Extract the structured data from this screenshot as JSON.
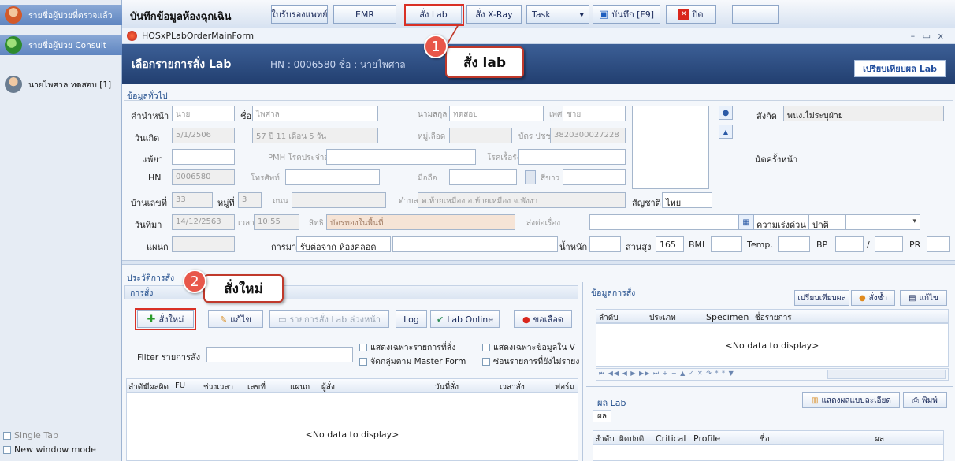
{
  "sidebar": {
    "items": [
      {
        "label": "รายชื่อผู้ป่วยที่ตรวจแล้ว",
        "color": "#5f85c0"
      },
      {
        "label": "รายชื่อผู้ป่วย Consult",
        "color": "#5f85c0"
      },
      {
        "label": "นายไพศาล ทดสอบ [1]",
        "color": "#dfe7f2"
      }
    ],
    "single_tab": "Single Tab",
    "new_window": "New window mode"
  },
  "toolbar": {
    "title": "บันทึกข้อมูลห้องฉุกเฉิน",
    "refer": "ใบรับรองแพทย์",
    "emr": "EMR",
    "lab": "สั่ง Lab",
    "xray": "สั่ง X-Ray",
    "task": "Task",
    "save": "บันทึก [F9]",
    "close": "ปิด"
  },
  "window": {
    "title": "HOSxPLabOrderMainForm",
    "controls": "–  ▭  x"
  },
  "header": {
    "title": "เลือกรายการสั่ง Lab",
    "hn": "HN : 0006580 ชื่อ : นายไพศาล",
    "compare": "เปรียบเทียบผล Lab"
  },
  "general": {
    "section": "ข้อมูลทั่วไป",
    "prefix_label": "คำนำหน้า",
    "prefix_value": "นาย",
    "fname_label": "ชื่อ",
    "fname_value": "ไพศาล",
    "lname_label": "นามสกุล",
    "lname_value": "ทดสอบ",
    "sex_label": "เพศ",
    "sex_value": "ชาย",
    "dob_label": "วันเกิด",
    "dob_value": "5/1/2506",
    "age_label": "อายุ",
    "age_value": "57 ปี 11 เดือน 5 วัน",
    "blood_label": "หมู่เลือด",
    "cid_label": "บัตร ปชช.",
    "cid_value": "3820300027228",
    "allergy_label": "แพ้ยา",
    "pmh_label": "PMH โรคประจำตัว",
    "disease_label": "โรคเรื้อรัง",
    "hn_label": "HN",
    "hn_value": "0006580",
    "phone_label": "โทรศัพท์",
    "mobile_label": "มือถือ",
    "ew_label": "สีขาว",
    "house_label": "บ้านเลขที่",
    "house_value": "33",
    "moo_label": "หมู่ที่",
    "moo_value": "3",
    "road_label": "ถนน",
    "tambon_label": "ตำบล",
    "tambon_value": "ต.ท้ายเหมือง อ.ท้ายเหมือง จ.พังงา",
    "nation_label": "สัญชาติ",
    "nation_value": "ไทย",
    "visit_label": "วันที่มา",
    "visit_value": "14/12/2563",
    "time_label": "เวลา",
    "time_value": "10:55",
    "right_label": "สิทธิ",
    "right_value": "บัตรทองในพื้นที่",
    "diag_label": "ส่งต่อเรื่อง",
    "dept_label": "แผนก",
    "trans_label": "การมา",
    "trans_value": "รับต่อจาก ห้องคลอด",
    "weight_label": "น้ำหนัก",
    "height_label": "ส่วนสูง",
    "height_value": "165",
    "bmi_label": "BMI",
    "temp_label": "Temp.",
    "bp_label": "BP",
    "bp_sep": "/",
    "pr_label": "PR",
    "affil_label": "สังกัด",
    "affil_value": "พนง.ไม่ระบุฝ่าย",
    "appoint_label": "นัดครั้งหน้า",
    "urgency_label": "ความเร่งด่วน",
    "urgency_value": "ปกติ"
  },
  "history": {
    "section": "ประวัติการสั่ง",
    "order_group": "การสั่ง",
    "btn_new": "สั่งใหม่",
    "btn_edit": "แก้ไข",
    "btn_preorder": "รายการสั่ง Lab ล่วงหน้า",
    "btn_log": "Log",
    "btn_online": "Lab Online",
    "btn_blood": "ขอเลือด",
    "filter_label": "Filter รายการสั่ง",
    "chk1": "แสดงเฉพาะรายการที่สั่ง",
    "chk2": "จัดกลุ่มตาม Master Form",
    "chk3": "แสดงเฉพาะข้อมูลใน V",
    "chk4": "ซ่อนรายการที่ยังไม่รายง",
    "columns": [
      "ลำดับ",
      "มีผลผิด",
      "FU",
      "ช่วงเวลา",
      "เลขที่",
      "แผนก",
      "ผู้สั่ง",
      "วันที่สั่ง",
      "เวลาสั่ง",
      "ฟอร์ม"
    ],
    "nodata": "<No data to display>"
  },
  "orderinfo": {
    "section": "ข้อมูลการสั่ง",
    "btn_compare": "เปรียบเทียบผล",
    "btn_reorder": "สั่งซ้ำ",
    "btn_edit": "แก้ไข",
    "columns": [
      "ลำดับ",
      "ประเภท",
      "Specimen",
      "ชื่อรายการ"
    ],
    "nodata": "<No data to display>",
    "nav": "⏮ ◀◀ ◀ ▶ ▶▶ ⏭ + − ▲ ✓ ✕ ↷ * * ▼"
  },
  "labresult": {
    "section": "ผล Lab",
    "btn_detail": "แสดงผลแบบละเอียด",
    "btn_print": "พิมพ์",
    "tab": "ผล",
    "columns": [
      "ลำดับ",
      "ผิดปกติ",
      "Critical",
      "Profile",
      "ชื่อ",
      "ผล"
    ]
  },
  "annotations": {
    "callout1": "สั่ง lab",
    "badge1": "1",
    "callout2": "สั่งใหม่",
    "badge2": "2"
  }
}
